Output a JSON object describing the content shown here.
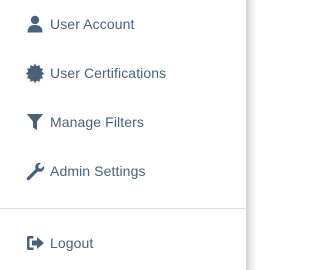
{
  "menu": {
    "items": [
      {
        "label": "User Account",
        "icon": "user-icon"
      },
      {
        "label": "User Certifications",
        "icon": "certificate-icon"
      },
      {
        "label": "Manage Filters",
        "icon": "filter-icon"
      },
      {
        "label": "Admin Settings",
        "icon": "wrench-icon"
      }
    ],
    "footer_items": [
      {
        "label": "Logout",
        "icon": "sign-out-icon"
      }
    ]
  },
  "colors": {
    "text": "#49617a",
    "icon": "#49617a",
    "divider": "#dcdcdc",
    "background": "#ffffff"
  }
}
